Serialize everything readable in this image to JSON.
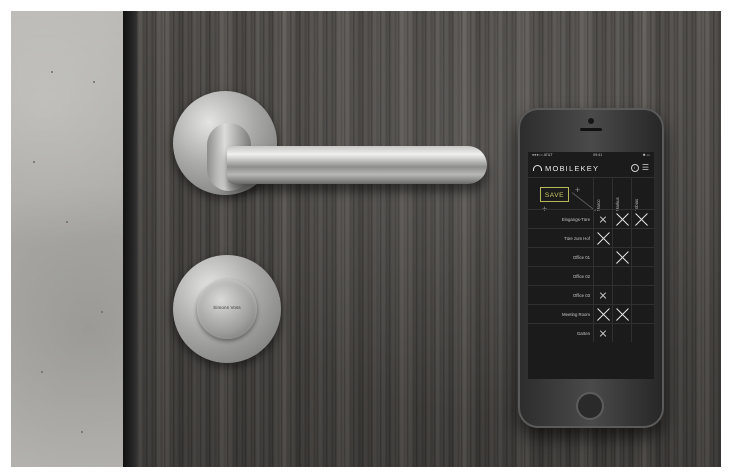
{
  "door_plate": {
    "brand": "Simons Voss"
  },
  "phone": {
    "status": {
      "carrier": "●●●○○ AT&T",
      "time": "09:41",
      "battery": "✱ ▭"
    },
    "app": {
      "name": "MOBILEKEY",
      "logo_icon": "arc-logo-icon",
      "info_icon": "info-icon",
      "menu_icon": "hamburger-menu-icon"
    },
    "toolbar": {
      "save_label": "SAVE",
      "add_column_symbol": "+",
      "add_row_symbol": "+"
    },
    "columns": [
      "Marco",
      "Markus",
      "Tobias"
    ],
    "rows": [
      {
        "label": "Eingangs-Türe",
        "cells": [
          "small",
          "big",
          "big"
        ]
      },
      {
        "label": "Türe zum Hof",
        "cells": [
          "big",
          "",
          ""
        ]
      },
      {
        "label": "Office 01",
        "cells": [
          "",
          "big",
          ""
        ]
      },
      {
        "label": "Office 02",
        "cells": [
          "",
          "",
          ""
        ]
      },
      {
        "label": "Office 03",
        "cells": [
          "small",
          "",
          ""
        ]
      },
      {
        "label": "Meeting Room",
        "cells": [
          "big",
          "big",
          ""
        ]
      },
      {
        "label": "Garten",
        "cells": [
          "small",
          "",
          ""
        ]
      }
    ],
    "accent_color": "#c8ca66"
  }
}
